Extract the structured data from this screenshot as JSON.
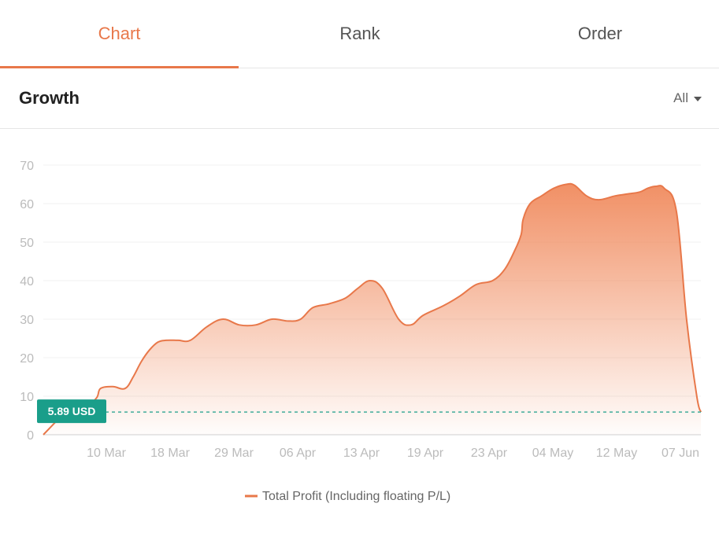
{
  "tabs": [
    {
      "label": "Chart",
      "active": true
    },
    {
      "label": "Rank",
      "active": false
    },
    {
      "label": "Order",
      "active": false
    }
  ],
  "section": {
    "title": "Growth",
    "range_value": "All"
  },
  "colors": {
    "accent": "#e8784a",
    "reference": "#1a9e8a",
    "grid": "#f0f0f0",
    "tick_text": "#bbbbbb"
  },
  "chart_data": {
    "type": "area",
    "title": "",
    "xlabel": "",
    "ylabel": "",
    "ylim": [
      0,
      70
    ],
    "y_ticks": [
      0,
      10,
      20,
      30,
      40,
      50,
      60,
      70
    ],
    "x_tick_labels": [
      "10 Mar",
      "18 Mar",
      "29 Mar",
      "06 Apr",
      "13 Apr",
      "19 Apr",
      "23 Apr",
      "04 May",
      "12 May",
      "07 Jun"
    ],
    "grid": true,
    "legend": {
      "position": "bottom",
      "entries": [
        "Total Profit (Including floating P/L)"
      ]
    },
    "reference_line": {
      "value": 5.89,
      "label": "5.89 USD"
    },
    "series": [
      {
        "name": "Total Profit (Including floating P/L)",
        "x_index": [
          0,
          0.5,
          0.6,
          1,
          1.3,
          1.4,
          1.7,
          2,
          2.2,
          2.4,
          2.6,
          2.8,
          3,
          3.3,
          3.6,
          4,
          4.4,
          4.8,
          5.2,
          5.6,
          6,
          6.3,
          6.6,
          7,
          7.4,
          7.7,
          8,
          8.3,
          8.7,
          9,
          9.3,
          9.8,
          10.2,
          10.6,
          11,
          11.3,
          11.55,
          11.7,
          11.75,
          11.92,
          12.2,
          12.5,
          12.8,
          13,
          13.3,
          13.6,
          14,
          14.3,
          14.6,
          14.8,
          15,
          15.2,
          15.5,
          15.75,
          16,
          16.1
        ],
        "values": [
          0,
          5.5,
          6.5,
          7,
          9.5,
          12,
          12.5,
          12,
          15,
          19,
          22,
          24,
          24.5,
          24.5,
          24.5,
          28,
          30,
          28.5,
          28.5,
          30,
          29.5,
          30,
          33,
          34,
          35.5,
          38,
          40,
          38,
          30,
          28.5,
          31,
          33.5,
          36,
          39,
          40,
          43,
          48,
          52,
          56,
          60,
          62,
          64,
          65,
          64.8,
          62,
          61,
          62,
          62.5,
          63,
          64,
          64.5,
          64,
          58,
          30,
          10,
          5.89
        ]
      }
    ]
  }
}
